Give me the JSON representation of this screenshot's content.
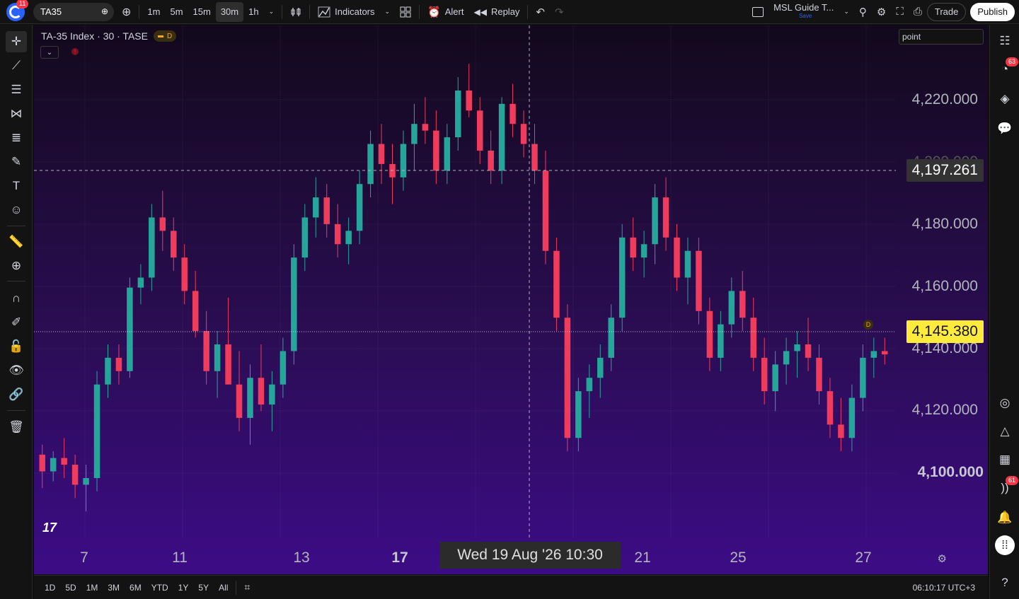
{
  "topbar": {
    "notification_count": "11",
    "symbol": "TA35",
    "timeframes": [
      "1m",
      "5m",
      "15m",
      "30m",
      "1h"
    ],
    "active_timeframe": "30m",
    "indicators_label": "Indicators",
    "alert_label": "Alert",
    "replay_label": "Replay",
    "layout_name": "MSL Guide T...",
    "layout_save": "Save",
    "trade_label": "Trade",
    "publish_label": "Publish"
  },
  "legend": {
    "title": "TA-35 Index · 30 · TASE",
    "market_status": "D"
  },
  "point_input": {
    "value": "point"
  },
  "price_axis": {
    "labels": [
      "4,220.000",
      "4,180.000",
      "4,160.000",
      "4,140.000",
      "4,120.000",
      "4,100.000"
    ],
    "crosshair_price": "4,197.261",
    "last_price": "4,145.380",
    "last_price_color": "#ffeb3b"
  },
  "time_axis": {
    "labels": [
      "7",
      "11",
      "13",
      "17",
      "21",
      "25",
      "27"
    ],
    "crosshair_time": "Wed 19 Aug '26   10:30"
  },
  "chart_marker": "D",
  "right_badges": {
    "ideas": "63",
    "stream": "61"
  },
  "bottombar": {
    "ranges": [
      "1D",
      "5D",
      "1M",
      "3M",
      "6M",
      "YTD",
      "1Y",
      "5Y",
      "All"
    ],
    "clock": "06:10:17 UTC+3"
  },
  "colors": {
    "up": "#26a69a",
    "down": "#ef3b5c",
    "accent": "#2962ff"
  },
  "chart_data": {
    "type": "candlestick",
    "y_range": [
      4090,
      4235
    ],
    "candles": [
      [
        4115,
        4118,
        4105,
        4110
      ],
      [
        4110,
        4116,
        4107,
        4114
      ],
      [
        4114,
        4120,
        4108,
        4112
      ],
      [
        4112,
        4115,
        4102,
        4106
      ],
      [
        4106,
        4112,
        4098,
        4108
      ],
      [
        4108,
        4140,
        4104,
        4136
      ],
      [
        4136,
        4148,
        4132,
        4144
      ],
      [
        4144,
        4148,
        4136,
        4140
      ],
      [
        4140,
        4168,
        4138,
        4165
      ],
      [
        4165,
        4172,
        4160,
        4168
      ],
      [
        4168,
        4190,
        4164,
        4186
      ],
      [
        4186,
        4194,
        4176,
        4182
      ],
      [
        4182,
        4186,
        4170,
        4174
      ],
      [
        4174,
        4178,
        4160,
        4164
      ],
      [
        4164,
        4170,
        4150,
        4152
      ],
      [
        4152,
        4158,
        4136,
        4140
      ],
      [
        4140,
        4152,
        4132,
        4148
      ],
      [
        4148,
        4162,
        4140,
        4136
      ],
      [
        4136,
        4146,
        4122,
        4126
      ],
      [
        4126,
        4142,
        4118,
        4138
      ],
      [
        4138,
        4148,
        4128,
        4130
      ],
      [
        4130,
        4140,
        4122,
        4136
      ],
      [
        4136,
        4150,
        4132,
        4146
      ],
      [
        4146,
        4178,
        4142,
        4174
      ],
      [
        4174,
        4190,
        4170,
        4186
      ],
      [
        4186,
        4198,
        4180,
        4192
      ],
      [
        4192,
        4196,
        4180,
        4184
      ],
      [
        4184,
        4190,
        4174,
        4178
      ],
      [
        4178,
        4186,
        4172,
        4182
      ],
      [
        4182,
        4200,
        4178,
        4196
      ],
      [
        4196,
        4212,
        4192,
        4208
      ],
      [
        4208,
        4214,
        4196,
        4202
      ],
      [
        4202,
        4208,
        4190,
        4198
      ],
      [
        4198,
        4212,
        4194,
        4208
      ],
      [
        4208,
        4220,
        4200,
        4214
      ],
      [
        4214,
        4222,
        4208,
        4212
      ],
      [
        4212,
        4218,
        4196,
        4200
      ],
      [
        4200,
        4214,
        4196,
        4210
      ],
      [
        4210,
        4228,
        4206,
        4224
      ],
      [
        4224,
        4232,
        4216,
        4218
      ],
      [
        4218,
        4222,
        4202,
        4206
      ],
      [
        4206,
        4212,
        4196,
        4200
      ],
      [
        4200,
        4222,
        4196,
        4220
      ],
      [
        4220,
        4226,
        4210,
        4214
      ],
      [
        4214,
        4218,
        4204,
        4208
      ],
      [
        4208,
        4214,
        4196,
        4200
      ],
      [
        4200,
        4206,
        4172,
        4176
      ],
      [
        4176,
        4180,
        4152,
        4156
      ],
      [
        4156,
        4160,
        4116,
        4120
      ],
      [
        4120,
        4138,
        4116,
        4134
      ],
      [
        4134,
        4142,
        4126,
        4138
      ],
      [
        4138,
        4148,
        4132,
        4144
      ],
      [
        4144,
        4160,
        4140,
        4156
      ],
      [
        4156,
        4184,
        4152,
        4180
      ],
      [
        4180,
        4186,
        4170,
        4174
      ],
      [
        4174,
        4182,
        4168,
        4178
      ],
      [
        4178,
        4196,
        4172,
        4192
      ],
      [
        4192,
        4198,
        4176,
        4180
      ],
      [
        4180,
        4184,
        4164,
        4168
      ],
      [
        4168,
        4180,
        4160,
        4176
      ],
      [
        4176,
        4180,
        4154,
        4158
      ],
      [
        4158,
        4162,
        4140,
        4144
      ],
      [
        4144,
        4158,
        4140,
        4154
      ],
      [
        4154,
        4168,
        4150,
        4164
      ],
      [
        4164,
        4170,
        4152,
        4156
      ],
      [
        4156,
        4162,
        4140,
        4144
      ],
      [
        4144,
        4150,
        4130,
        4134
      ],
      [
        4134,
        4146,
        4128,
        4142
      ],
      [
        4142,
        4150,
        4136,
        4146
      ],
      [
        4146,
        4152,
        4138,
        4148
      ],
      [
        4148,
        4156,
        4140,
        4144
      ],
      [
        4144,
        4148,
        4130,
        4134
      ],
      [
        4134,
        4138,
        4120,
        4124
      ],
      [
        4124,
        4132,
        4116,
        4120
      ],
      [
        4120,
        4136,
        4116,
        4132
      ],
      [
        4132,
        4148,
        4128,
        4144
      ],
      [
        4144,
        4150,
        4138,
        4146
      ],
      [
        4146,
        4150,
        4142,
        4145
      ]
    ]
  }
}
